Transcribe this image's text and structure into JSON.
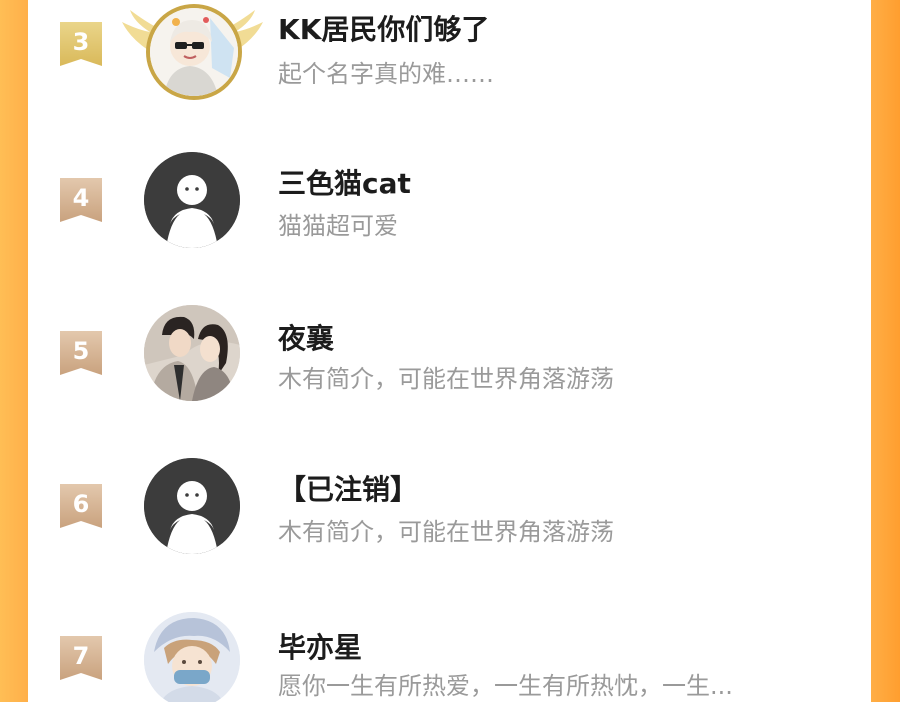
{
  "colors": {
    "background_orange": "#ffb24b",
    "panel": "#ffffff",
    "rank_gold": "#d9b95a",
    "rank_bronze": "#c9a27e",
    "name_text": "#1c1c1c",
    "bio_text": "#9a9a9a",
    "default_avatar": "#3c3c3c"
  },
  "rows": [
    {
      "rank": "3",
      "name": "KK居民你们够了",
      "bio": "起个名字真的难……",
      "avatar": "anime-avatar-with-sunglasses"
    },
    {
      "rank": "4",
      "name": "三色猫cat",
      "bio": "猫猫超可爱",
      "avatar": "default-avatar"
    },
    {
      "rank": "5",
      "name": "夜襄",
      "bio": "木有简介，可能在世界角落游荡",
      "avatar": "couple-illustration-avatar"
    },
    {
      "rank": "6",
      "name": "【已注销】",
      "bio": "木有简介，可能在世界角落游荡",
      "avatar": "default-avatar"
    },
    {
      "rank": "7",
      "name": "毕亦星",
      "bio": "愿你一生有所热爱，一生有所热忱，一生...",
      "avatar": "anime-boy-avatar"
    }
  ]
}
